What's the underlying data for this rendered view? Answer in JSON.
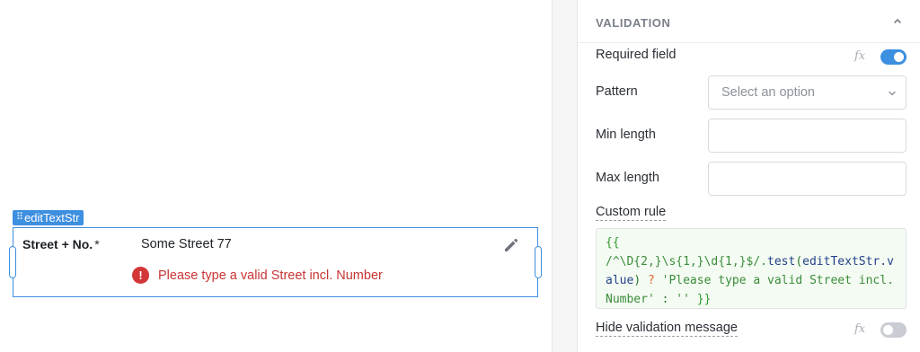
{
  "canvas": {
    "component_name": "editTextStr",
    "field": {
      "label": "Street + No.",
      "required_marker": "*",
      "value": "Some Street 77",
      "error_icon_glyph": "!",
      "error_message": "Please type a valid Street incl. Number"
    }
  },
  "panel": {
    "section_title": "VALIDATION",
    "required_field": {
      "label": "Required field",
      "fx_label": "fx",
      "toggle_on": true
    },
    "pattern": {
      "label": "Pattern",
      "placeholder": "Select an option"
    },
    "min_length": {
      "label": "Min length",
      "value": ""
    },
    "max_length": {
      "label": "Max length",
      "value": ""
    },
    "custom_rule": {
      "label": "Custom rule",
      "code": {
        "open": "{{",
        "regex": "/^\\D{2,}\\s{1,}\\d{1,}$/.",
        "fn": "test",
        "paren_open": "(",
        "var": "editTextStr.value",
        "paren_close": ")",
        "ternary_q": " ? ",
        "str_true": "'Please type a valid Street incl. Number'",
        "ternary_colon": " : ",
        "str_false": "''",
        "close": " }}"
      }
    },
    "hide_validation_message": {
      "label": "Hide validation message",
      "fx_label": "fx",
      "toggle_on": false
    }
  },
  "colors": {
    "accent": "#3d8fe0",
    "error": "#c93434",
    "code_background": "#f4fbf2"
  },
  "icons": {
    "drag_handle": "drag-dots-icon",
    "edit": "pencil-icon",
    "error": "error-circle-icon",
    "collapse": "chevron-up-icon",
    "select": "chevron-down-icon"
  }
}
